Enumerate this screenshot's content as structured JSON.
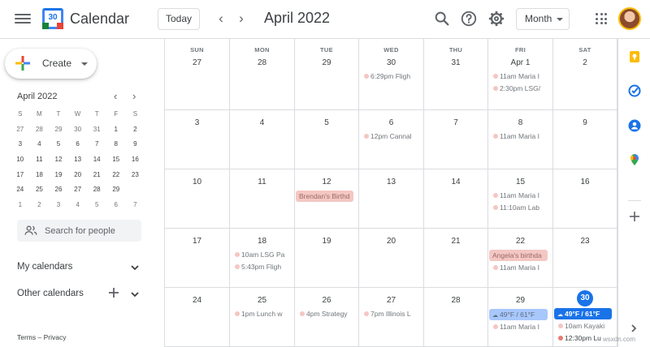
{
  "header": {
    "app_title": "Calendar",
    "logo_number": "30",
    "today_label": "Today",
    "month_title": "April 2022",
    "view_label": "Month"
  },
  "sidebar": {
    "create_label": "Create",
    "mini_calendar": {
      "title": "April 2022",
      "day_names": [
        "S",
        "M",
        "T",
        "W",
        "T",
        "F",
        "S"
      ],
      "weeks": [
        [
          "27",
          "28",
          "29",
          "30",
          "31",
          "1",
          "2"
        ],
        [
          "3",
          "4",
          "5",
          "6",
          "7",
          "8",
          "9"
        ],
        [
          "10",
          "11",
          "12",
          "13",
          "14",
          "15",
          "16"
        ],
        [
          "17",
          "18",
          "19",
          "20",
          "21",
          "22",
          "23"
        ],
        [
          "24",
          "25",
          "26",
          "27",
          "28",
          "29",
          "30"
        ],
        [
          "1",
          "2",
          "3",
          "4",
          "5",
          "6",
          "7"
        ]
      ]
    },
    "search_people_placeholder": "Search for people",
    "my_calendars_label": "My calendars",
    "other_calendars_label": "Other calendars",
    "footer_terms": "Terms",
    "footer_sep": "–",
    "footer_privacy": "Privacy"
  },
  "grid": {
    "day_headers": [
      "SUN",
      "MON",
      "TUE",
      "WED",
      "THU",
      "FRI",
      "SAT"
    ],
    "weeks": [
      [
        {
          "date": "27",
          "events": []
        },
        {
          "date": "28",
          "events": []
        },
        {
          "date": "29",
          "events": []
        },
        {
          "date": "30",
          "events": [
            {
              "text": "6:29pm Fligh",
              "style": "dot"
            }
          ]
        },
        {
          "date": "31",
          "events": []
        },
        {
          "date": "Apr 1",
          "events": [
            {
              "text": "11am Maria I",
              "style": "dot"
            },
            {
              "text": "2:30pm LSG/",
              "style": "dot"
            }
          ]
        },
        {
          "date": "2",
          "events": []
        }
      ],
      [
        {
          "date": "3",
          "events": []
        },
        {
          "date": "4",
          "events": []
        },
        {
          "date": "5",
          "events": []
        },
        {
          "date": "6",
          "events": [
            {
              "text": "12pm Cannal",
              "style": "dot"
            }
          ]
        },
        {
          "date": "7",
          "events": []
        },
        {
          "date": "8",
          "events": [
            {
              "text": "11am Maria I",
              "style": "dot"
            }
          ]
        },
        {
          "date": "9",
          "events": []
        }
      ],
      [
        {
          "date": "10",
          "events": []
        },
        {
          "date": "11",
          "events": []
        },
        {
          "date": "12",
          "events": [
            {
              "text": "Brendan's Birthd",
              "style": "chip"
            }
          ]
        },
        {
          "date": "13",
          "events": []
        },
        {
          "date": "14",
          "events": []
        },
        {
          "date": "15",
          "events": [
            {
              "text": "11am Maria I",
              "style": "dot"
            },
            {
              "text": "11:10am Lab",
              "style": "dot"
            }
          ]
        },
        {
          "date": "16",
          "events": []
        }
      ],
      [
        {
          "date": "17",
          "events": []
        },
        {
          "date": "18",
          "events": [
            {
              "text": "10am LSG Pa",
              "style": "dot"
            },
            {
              "text": "5:43pm Fligh",
              "style": "dot"
            }
          ]
        },
        {
          "date": "19",
          "events": []
        },
        {
          "date": "20",
          "events": []
        },
        {
          "date": "21",
          "events": []
        },
        {
          "date": "22",
          "events": [
            {
              "text": "Angela's birthda",
              "style": "chip"
            },
            {
              "text": "11am Maria I",
              "style": "dot"
            }
          ]
        },
        {
          "date": "23",
          "events": []
        }
      ],
      [
        {
          "date": "24",
          "events": []
        },
        {
          "date": "25",
          "events": [
            {
              "text": "1pm Lunch w",
              "style": "dot"
            }
          ]
        },
        {
          "date": "26",
          "events": [
            {
              "text": "4pm Strategy",
              "style": "dot"
            }
          ]
        },
        {
          "date": "27",
          "events": [
            {
              "text": "7pm Illinois L",
              "style": "dot"
            }
          ]
        },
        {
          "date": "28",
          "events": []
        },
        {
          "date": "29",
          "events": [
            {
              "text": "49°F / 61°F",
              "style": "weather"
            },
            {
              "text": "11am Maria I",
              "style": "dot"
            }
          ]
        },
        {
          "date": "30",
          "today": true,
          "events": [
            {
              "text": "49°F / 61°F",
              "style": "weather-strong"
            },
            {
              "text": "10am Kayaki",
              "style": "dot"
            },
            {
              "text": "12:30pm Lu",
              "style": "dot-red"
            }
          ]
        }
      ]
    ]
  },
  "watermark": "wsxdn.com",
  "colors": {
    "accent_blue": "#1a73e8",
    "event_pink": "#f4c7c3",
    "event_red": "#e67c73",
    "weather_light": "#a8c7fa"
  }
}
